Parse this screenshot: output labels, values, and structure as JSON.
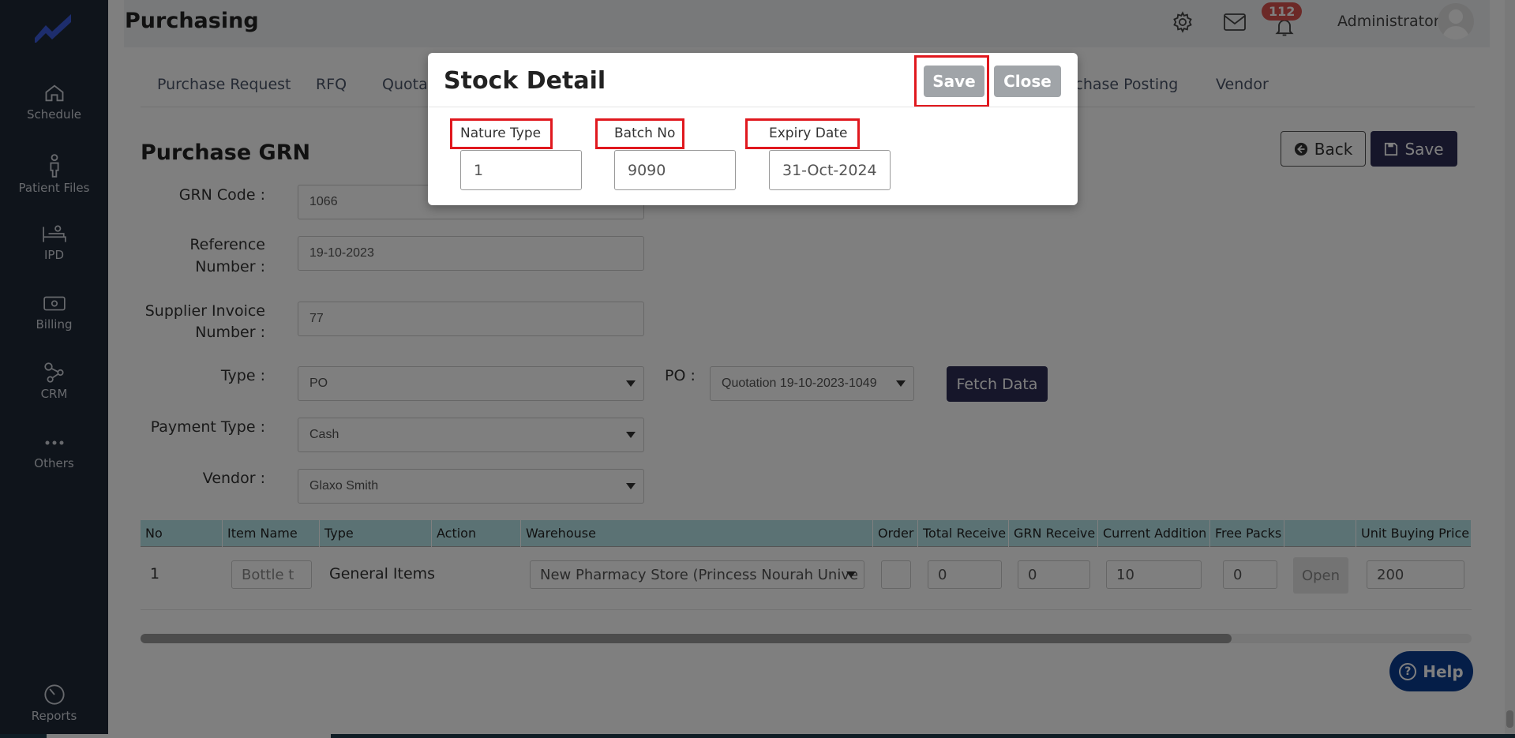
{
  "sidebar": {
    "items": [
      {
        "label": "Schedule",
        "icon": "home-icon"
      },
      {
        "label": "Patient Files",
        "icon": "person-icon"
      },
      {
        "label": "IPD",
        "icon": "bed-icon"
      },
      {
        "label": "Billing",
        "icon": "money-icon"
      },
      {
        "label": "CRM",
        "icon": "network-icon"
      },
      {
        "label": "Others",
        "icon": "more-icon"
      },
      {
        "label": "Reports",
        "icon": "pie-chart-icon"
      }
    ]
  },
  "header": {
    "title": "Purchasing",
    "notification_count": "112",
    "user_name": "Administrator"
  },
  "tabs": [
    "Purchase Request",
    "RFQ",
    "Quotat",
    "rchase Posting",
    "Vendor"
  ],
  "section": {
    "title": "Purchase GRN",
    "back_label": "Back",
    "save_label": "Save"
  },
  "form": {
    "grn_code_label": "GRN Code :",
    "grn_code": "1066",
    "reference_label_1": "Reference",
    "reference_label_2": "Number :",
    "reference": "19-10-2023",
    "supplier_label_1": "Supplier Invoice",
    "supplier_label_2": "Number :",
    "supplier_invoice": "77",
    "type_label": "Type :",
    "type_value": "PO",
    "po_label": "PO :",
    "po_value": "Quotation 19-10-2023-1049",
    "fetch_label": "Fetch Data",
    "payment_label": "Payment Type :",
    "payment_value": "Cash",
    "vendor_label": "Vendor :",
    "vendor_value": "Glaxo Smith"
  },
  "table": {
    "headers": [
      "No",
      "Item Name",
      "Type",
      "Action",
      "Warehouse",
      "Order",
      "Total Receive",
      "GRN Receive",
      "Current Addition",
      "Free Packs",
      "",
      "Unit Buying Price"
    ],
    "row": {
      "no": "1",
      "item_name": "Bottle t",
      "type": "General Items",
      "warehouse": "New Pharmacy Store (Princess Nourah Unive",
      "order": "",
      "total_receive": "0",
      "grn_receive": "0",
      "current_addition": "10",
      "free_packs": "0",
      "open_label": "Open",
      "unit_price": "200"
    }
  },
  "help_label": "Help",
  "modal": {
    "title": "Stock Detail",
    "save_label": "Save",
    "close_label": "Close",
    "nature_type_label": "Nature Type",
    "nature_type": "1",
    "batch_no_label": "Batch No",
    "batch_no": "9090",
    "expiry_label": "Expiry Date",
    "expiry_date": "31-Oct-2024"
  },
  "colors": {
    "sidebar_bg": "#1f2937",
    "primary_button": "#2c2c54",
    "table_header": "#b7e4e9",
    "highlight_red": "#e0181e",
    "help_blue": "#0b3d91",
    "badge_red": "#d9534f"
  }
}
